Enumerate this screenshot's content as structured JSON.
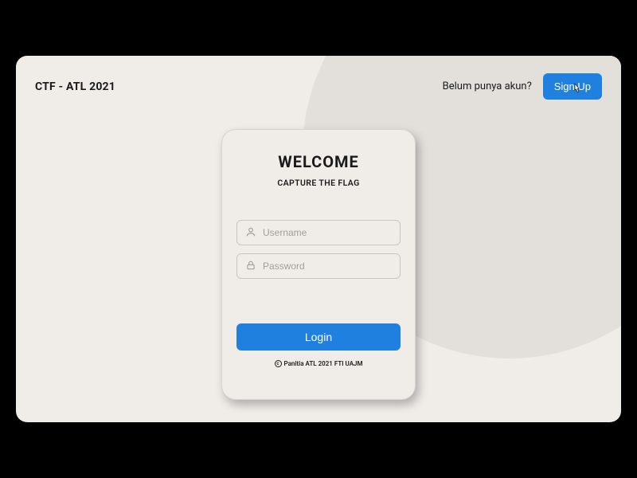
{
  "header": {
    "brand": "CTF - ATL 2021",
    "prompt": "Belum punya akun?",
    "signup_label": "Sign Up"
  },
  "card": {
    "title": "WELCOME",
    "subtitle": "CAPTURE THE FLAG",
    "username_placeholder": "Username",
    "password_placeholder": "Password",
    "login_label": "Login",
    "copyright": "Panitia ATL 2021 FTI UAJM"
  },
  "colors": {
    "accent": "#1f80e0",
    "bg": "#f0ede9",
    "circle": "#e3e0dc"
  }
}
